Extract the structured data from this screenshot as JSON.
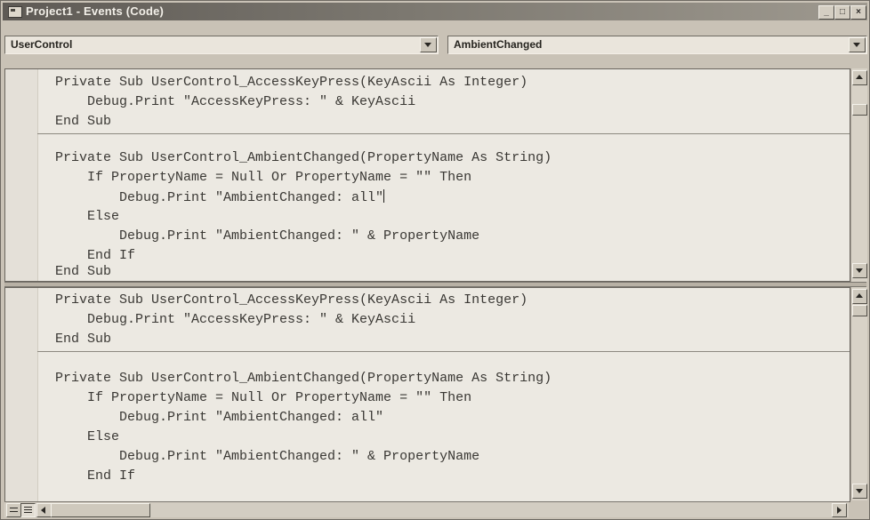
{
  "window": {
    "title": "Project1 - Events (Code)"
  },
  "selectors": {
    "object": "UserControl",
    "procedure": "AmbientChanged"
  },
  "top_pane": {
    "lines": [
      "Private Sub UserControl_AccessKeyPress(KeyAscii As Integer)",
      "    Debug.Print \"AccessKeyPress: \" & KeyAscii",
      "End Sub",
      "Private Sub UserControl_AmbientChanged(PropertyName As String)",
      "    If PropertyName = Null Or PropertyName = \"\" Then",
      "        Debug.Print \"AmbientChanged: all\"",
      "    Else",
      "        Debug.Print \"AmbientChanged: \" & PropertyName",
      "    End If",
      "End Sub"
    ]
  },
  "bottom_pane": {
    "lines": [
      "Private Sub UserControl_AccessKeyPress(KeyAscii As Integer)",
      "    Debug.Print \"AccessKeyPress: \" & KeyAscii",
      "End Sub",
      "Private Sub UserControl_AmbientChanged(PropertyName As String)",
      "    If PropertyName = Null Or PropertyName = \"\" Then",
      "        Debug.Print \"AmbientChanged: all\"",
      "    Else",
      "        Debug.Print \"AmbientChanged: \" & PropertyName",
      "    End If"
    ]
  },
  "icons": {
    "app": "code-window-icon",
    "minimize": "minimize-icon",
    "maximize": "maximize-icon",
    "close": "close-icon",
    "procedure_view": "procedure-view-icon",
    "full_module_view": "full-module-view-icon"
  },
  "colors": {
    "titlebar": "#5e5a55",
    "code_background": "#ece9e2",
    "code_text": "#3a3834"
  }
}
